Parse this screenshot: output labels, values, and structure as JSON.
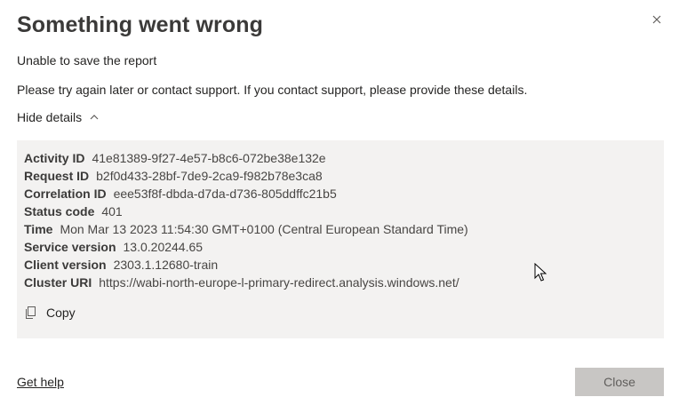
{
  "dialog": {
    "title": "Something went wrong",
    "message": "Unable to save the report",
    "instructions": "Please try again later or contact support. If you contact support, please provide these details.",
    "toggle_label": "Hide details",
    "details": [
      {
        "key": "Activity ID",
        "value": "41e81389-9f27-4e57-b8c6-072be38e132e"
      },
      {
        "key": "Request ID",
        "value": "b2f0d433-28bf-7de9-2ca9-f982b78e3ca8"
      },
      {
        "key": "Correlation ID",
        "value": "eee53f8f-dbda-d7da-d736-805ddffc21b5"
      },
      {
        "key": "Status code",
        "value": "401"
      },
      {
        "key": "Time",
        "value": "Mon Mar 13 2023 11:54:30 GMT+0100 (Central European Standard Time)"
      },
      {
        "key": "Service version",
        "value": "13.0.20244.65"
      },
      {
        "key": "Client version",
        "value": "2303.1.12680-train"
      },
      {
        "key": "Cluster URI",
        "value": "https://wabi-north-europe-l-primary-redirect.analysis.windows.net/"
      }
    ],
    "copy_label": "Copy",
    "help_link": "Get help",
    "close_button": "Close",
    "icons": {
      "close": "close-icon",
      "toggle": "chevron-up-icon",
      "copy": "copy-icon",
      "cursor": "mouse-pointer-icon"
    }
  }
}
